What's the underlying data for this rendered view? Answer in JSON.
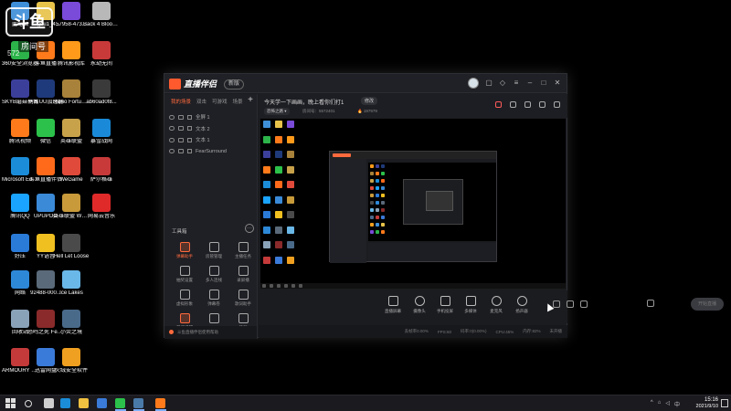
{
  "watermark": {
    "logo": "斗鱼",
    "text": "房间号",
    "number": "572"
  },
  "desktop_icons": [
    {
      "label": "此电脑",
      "color": "#3f8fd8",
      "col": 0,
      "row": 0
    },
    {
      "label": "360安全浏览器",
      "color": "#2cb34a",
      "col": 0,
      "row": 1
    },
    {
      "label": "SKYB蘑菇平台",
      "color": "#3c3f9a",
      "col": 0,
      "row": 2
    },
    {
      "label": "腾讯视频",
      "color": "#ff7a1a",
      "col": 0,
      "row": 3
    },
    {
      "label": "Microsoft Edge",
      "color": "#1b8cd8",
      "col": 0,
      "row": 4
    },
    {
      "label": "腾讯QQ",
      "color": "#1aa3ff",
      "col": 0,
      "row": 5
    },
    {
      "label": "好压",
      "color": "#2a7ad8",
      "col": 0,
      "row": 6
    },
    {
      "label": "网络",
      "color": "#2d88d8",
      "col": 0,
      "row": 7
    },
    {
      "label": "回收站",
      "color": "#8aa2b8",
      "col": 0,
      "row": 8
    },
    {
      "label": "ARMOURY CRATE",
      "color": "#c43a3a",
      "col": 0,
      "row": 9
    },
    {
      "label": "kugou1_4...",
      "color": "#e8c34a",
      "col": 1,
      "row": 0
    },
    {
      "label": "斗鱼直播",
      "color": "#ff7a1a",
      "col": 1,
      "row": 1
    },
    {
      "label": "网易UU加速器",
      "color": "#1f3a7a",
      "col": 1,
      "row": 2
    },
    {
      "label": "微信",
      "color": "#2cc14a",
      "col": 1,
      "row": 3
    },
    {
      "label": "斗鱼直播伴侣",
      "color": "#ff6a1a",
      "col": 1,
      "row": 4
    },
    {
      "label": "UPUPOO",
      "color": "#3a8ad8",
      "col": 1,
      "row": 5
    },
    {
      "label": "YY语音",
      "color": "#f0c020",
      "col": 1,
      "row": 6
    },
    {
      "label": "92488-000...",
      "color": "#5a6a7a",
      "col": 1,
      "row": 7
    },
    {
      "label": "恐鸣之死 Fear sur...",
      "color": "#8a2a2a",
      "col": 1,
      "row": 8
    },
    {
      "label": "迅雷网盘",
      "color": "#3a7ad8",
      "col": 1,
      "row": 9
    },
    {
      "label": "57958-473...",
      "color": "#7a4ad8",
      "col": 2,
      "row": 0
    },
    {
      "label": "腾讯影视库",
      "color": "#ff9a1a",
      "col": 2,
      "row": 1
    },
    {
      "label": "Ravio Fortune -...",
      "color": "#a8823a",
      "col": 2,
      "row": 2
    },
    {
      "label": "英雄联盟",
      "color": "#c8a24a",
      "col": 2,
      "row": 3
    },
    {
      "label": "WeGame",
      "color": "#e04a3a",
      "col": 2,
      "row": 4
    },
    {
      "label": "英雄联盟 WeGame版",
      "color": "#c89a3a",
      "col": 2,
      "row": 5
    },
    {
      "label": "Hell Let Loose",
      "color": "#4a4a4a",
      "col": 2,
      "row": 6
    },
    {
      "label": "Ice Lakes",
      "color": "#6ab8e8",
      "col": 2,
      "row": 7
    },
    {
      "label": "小荧之境",
      "color": "#4a6a8a",
      "col": 2,
      "row": 8
    },
    {
      "label": "火绒安全软件",
      "color": "#f0a020",
      "col": 2,
      "row": 9
    },
    {
      "label": "Back 4 Blood Beta",
      "color": "#b8b8b8",
      "col": 3,
      "row": 0
    },
    {
      "label": "永劫无间",
      "color": "#c83a3a",
      "col": 3,
      "row": 1
    },
    {
      "label": "ab60ad0f8...",
      "color": "#3a3a3a",
      "col": 3,
      "row": 2
    },
    {
      "label": "暴雪战网",
      "color": "#1a8ad8",
      "col": 3,
      "row": 3
    },
    {
      "label": "萨尔格雄",
      "color": "#c83a3a",
      "col": 3,
      "row": 4
    },
    {
      "label": "网易云音乐",
      "color": "#e02a2a",
      "col": 3,
      "row": 5
    }
  ],
  "app": {
    "brand": "直播伴侣",
    "version": "新版",
    "scene_tabs": [
      "我的场景",
      "双击",
      "可游戏",
      "场景"
    ],
    "sources": [
      "全屏 1",
      "文本 2",
      "文本 1",
      "FearSurround"
    ],
    "toolbox_title": "工具箱",
    "tools": [
      "弹幕助手",
      "房管管理",
      "主播任务",
      "抽奖设置",
      "多人连线",
      "录屏播",
      "虚拟形象",
      "弹幕卷",
      "歌词助手",
      "开播提醒",
      "",
      "美颜"
    ],
    "room_title": "今天学一下画画，晚上看你们打1",
    "room_edit": "修改",
    "room_category": "恐怖之路 ▾",
    "room_id_label": "房间号：5572401",
    "room_hot": "🔥 197979",
    "controls": [
      "直播屏幕",
      "摄像头",
      "手机投屏",
      "多媒体",
      "麦克风",
      "扬声器"
    ],
    "start_button": "开始直播",
    "status": [
      "丢帧率0.00%",
      "FPS:60",
      "码率:0(0.00%)",
      "CPU:45%",
      "内存:82%",
      "未开播"
    ],
    "bottom_notice": "斗鱼直播伴侣使用帮助"
  },
  "taskbar": {
    "clock": "15:16",
    "date": "2021/9/10",
    "apps": [
      {
        "name": "task-view",
        "color": "#cfcfcf"
      },
      {
        "name": "edge",
        "color": "#1b8cd8"
      },
      {
        "name": "file-explorer",
        "color": "#f0c040"
      },
      {
        "name": "store",
        "color": "#3a7ad8"
      },
      {
        "name": "wechat",
        "color": "#2cc14a"
      },
      {
        "name": "steam",
        "color": "#4a7aa8"
      },
      {
        "name": "douyu",
        "color": "#ff7a1a"
      }
    ]
  }
}
